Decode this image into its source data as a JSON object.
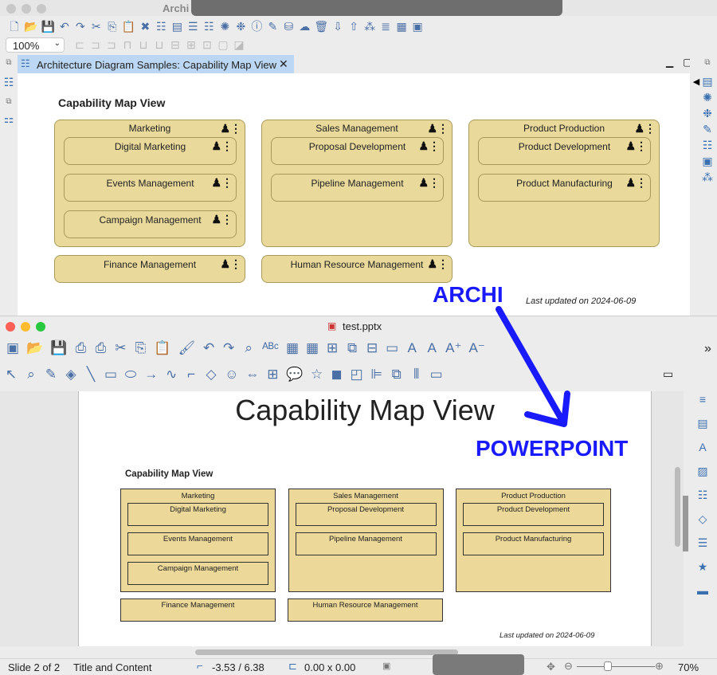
{
  "archi": {
    "title": "Archi",
    "zoom_value": "100%",
    "tab_label": "Architecture Diagram Samples: Capability Map View",
    "diagram": {
      "title": "Capability Map View",
      "groups": [
        {
          "label": "Marketing",
          "children": [
            "Digital Marketing",
            "Events Management",
            "Campaign Management"
          ]
        },
        {
          "label": "Sales Management",
          "children": [
            "Proposal Development",
            "Pipeline Management"
          ]
        },
        {
          "label": "Product Production",
          "children": [
            "Product Development",
            "Product Manufacturing"
          ]
        }
      ],
      "singles": [
        "Finance Management",
        "Human Resource Management"
      ],
      "footer": "Last updated on 2024-06-09"
    },
    "toolbar1": [
      "new-icon",
      "open-icon",
      "save-icon",
      "undo-icon",
      "redo-icon",
      "cut-icon",
      "copy-icon",
      "paste-icon",
      "delete-icon",
      "tree-icon",
      "properties-icon",
      "outline-icon",
      "navigator-icon",
      "palette-icon",
      "network-icon",
      "info-icon",
      "validate-icon",
      "database-icon",
      "cloud-icon",
      "trash-icon",
      "import-icon",
      "export-icon",
      "model-icon",
      "script-icon",
      "report-icon",
      "preview-icon"
    ],
    "toolbar2": [
      "align-left-icon",
      "align-center-icon",
      "align-right-icon",
      "align-top-icon",
      "align-middle-icon",
      "align-bottom-icon",
      "match-width-icon",
      "match-height-icon",
      "match-size-icon",
      "default-size-icon",
      "reset-icon"
    ]
  },
  "ppt": {
    "title": "test.pptx",
    "slide_title": "Capability Map View",
    "diagram": {
      "title": "Capability Map View",
      "groups": [
        {
          "label": "Marketing",
          "children": [
            "Digital Marketing",
            "Events Management",
            "Campaign Management"
          ]
        },
        {
          "label": "Sales Management",
          "children": [
            "Proposal Development",
            "Pipeline Management"
          ]
        },
        {
          "label": "Product Production",
          "children": [
            "Product Development",
            "Product Manufacturing"
          ]
        }
      ],
      "singles": [
        "Finance Management",
        "Human Resource Management"
      ],
      "footer": "Last updated on 2024-06-09"
    },
    "status": {
      "slide": "Slide 2 of 2",
      "layout": "Title and Content",
      "position": "-3.53 / 6.38",
      "size": "0.00 x 0.00",
      "zoom": "70%",
      "zoom_level": 0.4
    },
    "toolbar1": [
      "slide-icon",
      "open-icon",
      "save-icon",
      "pdf-icon",
      "print-icon",
      "cut-icon",
      "copy-icon",
      "paste-icon",
      "clone-format-icon",
      "undo-icon",
      "redo-icon",
      "find-icon",
      "spelling-icon",
      "grid-icon",
      "snap-icon",
      "new-slide-icon",
      "duplicate-slide-icon",
      "delete-slide-icon",
      "comment-icon",
      "font-color-icon",
      "font-icon",
      "grow-font-icon",
      "shrink-font-icon"
    ],
    "toolbar2": [
      "select-icon",
      "zoom-icon",
      "line-color-icon",
      "fill-color-icon",
      "line-icon",
      "rectangle-icon",
      "ellipse-icon",
      "arrow-icon",
      "curve-icon",
      "connector-icon",
      "diamond-icon",
      "smiley-icon",
      "double-arrow-icon",
      "flowchart-icon",
      "callout-icon",
      "star-icon",
      "3d-icon",
      "shadow-icon",
      "align-icon",
      "arrange-icon",
      "distribute-icon",
      "more-icon"
    ],
    "sidebar": [
      "menu-icon",
      "properties-icon",
      "styles-icon",
      "gallery-icon",
      "navigator-icon",
      "shapes-icon",
      "animation-icon",
      "transition-icon",
      "master-icon"
    ]
  },
  "annotations": {
    "archi_label": "ARCHI",
    "ppt_label": "POWERPOINT",
    "color": "#1a1aff"
  }
}
